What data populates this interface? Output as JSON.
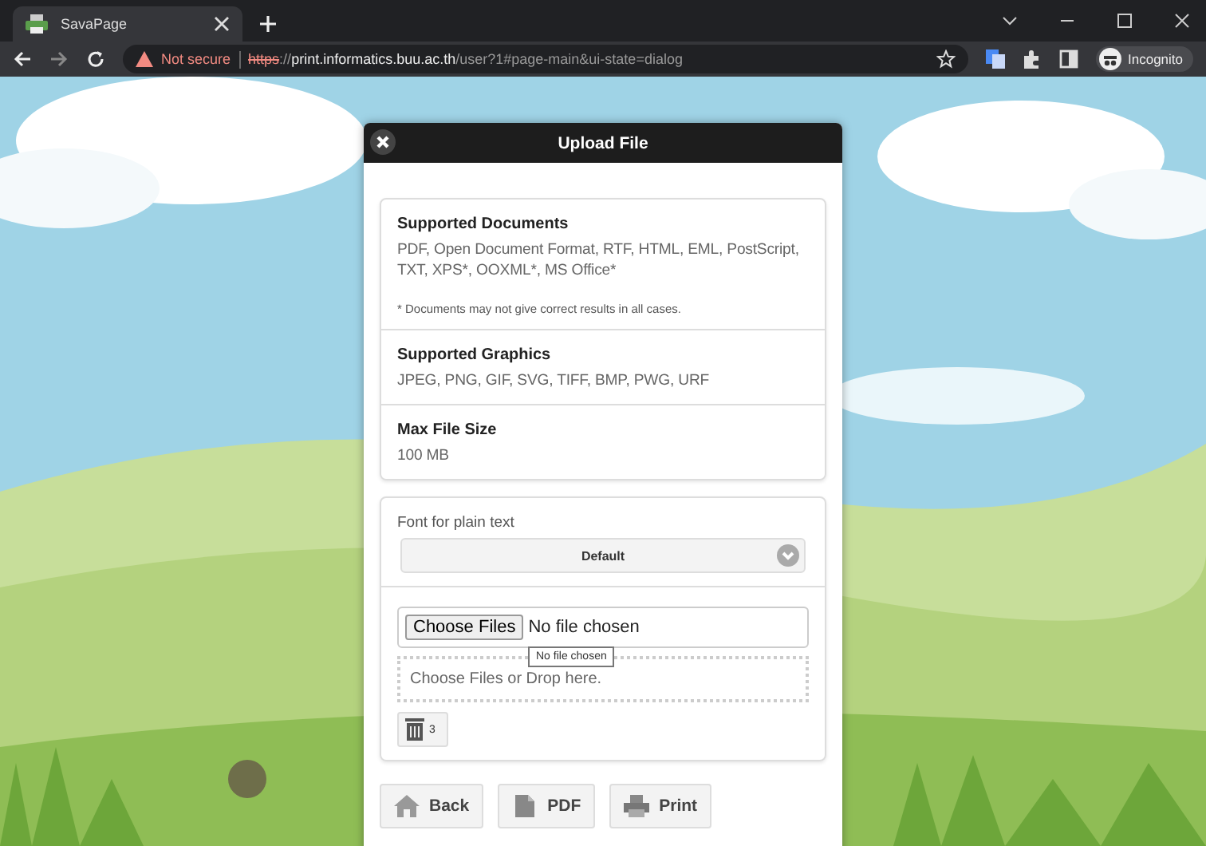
{
  "browser": {
    "tab": {
      "title": "SavaPage",
      "selected": true
    },
    "address": {
      "security": "Not secure",
      "scheme": "https",
      "separator": "://",
      "host": "print.informatics.buu.ac.th",
      "path": "/user?1#page-main&ui-state=dialog"
    },
    "profile": "Incognito"
  },
  "dialog": {
    "title": "Upload File",
    "info": [
      {
        "heading": "Supported Documents",
        "text": "PDF, Open Document Format, RTF, HTML, EML, PostScript, TXT, XPS*, OOXML*, MS Office*",
        "note": "* Documents may not give correct results in all cases."
      },
      {
        "heading": "Supported Graphics",
        "text": "JPEG, PNG, GIF, SVG, TIFF, BMP, PWG, URF"
      },
      {
        "heading": "Max File Size",
        "text": "100 MB"
      }
    ],
    "font": {
      "label": "Font for plain text",
      "value": "Default"
    },
    "file_input": {
      "button": "Choose Files",
      "value": "No file chosen",
      "tooltip": "No file chosen"
    },
    "drop_zone": {
      "text": "Choose Files or Drop here."
    },
    "trash": {
      "count": "3"
    },
    "buttons": [
      {
        "kind": "home",
        "label": "Back"
      },
      {
        "kind": "pdf",
        "label": "PDF"
      },
      {
        "kind": "print",
        "label": "Print"
      }
    ]
  }
}
